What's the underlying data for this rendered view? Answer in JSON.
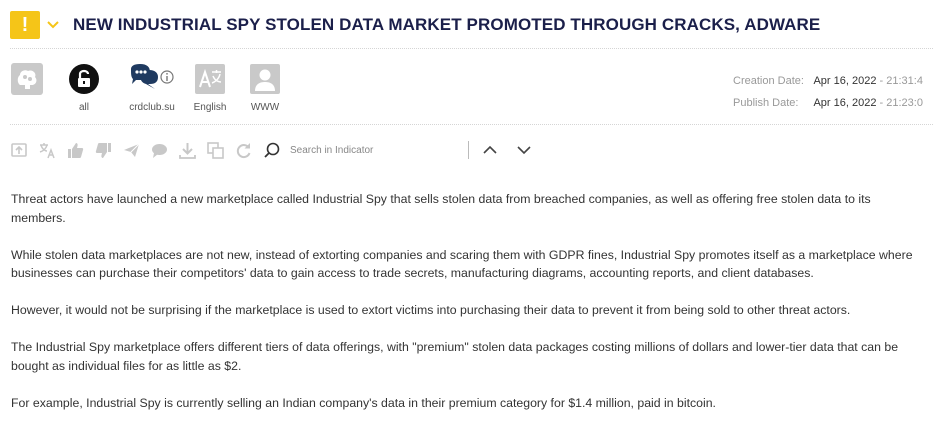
{
  "header": {
    "badge": "!",
    "title": "NEW INDUSTRIAL SPY STOLEN DATA MARKET PROMOTED THROUGH CRACKS, ADWARE"
  },
  "meta": {
    "items": [
      {
        "icon": "brain-icon",
        "label": ""
      },
      {
        "icon": "lock-open-icon",
        "label": "all"
      },
      {
        "icon": "chat-icon",
        "label": "crdclub.su"
      },
      {
        "icon": "translate-icon",
        "label": "English"
      },
      {
        "icon": "user-icon",
        "label": "WWW"
      }
    ]
  },
  "dates": {
    "creation_label": "Creation Date:",
    "creation_date": "Apr 16, 2022",
    "creation_time": "21:31:4",
    "publish_label": "Publish Date:",
    "publish_date": "Apr 16, 2022",
    "publish_time": "21:23:0"
  },
  "toolbar": {
    "search_placeholder": "Search in Indicator"
  },
  "content": {
    "paragraphs": [
      "Threat actors have launched a new marketplace called Industrial Spy that sells stolen data from breached companies, as well as offering free stolen data to its members.",
      "While stolen data marketplaces are not new, instead of extorting companies and scaring them with GDPR fines, Industrial Spy promotes itself as a marketplace where businesses can purchase their competitors' data to gain access to trade secrets, manufacturing diagrams, accounting reports, and client databases.",
      "However, it would not be surprising if the marketplace is used to extort victims into purchasing their data to prevent it from being sold to other threat actors.",
      "The Industrial Spy marketplace offers different tiers of data offerings, with \"premium\" stolen data packages costing millions of dollars and lower-tier data that can be bought as individual files for as little as $2.",
      "For example, Industrial Spy is currently selling an Indian company's data in their premium category for $1.4 million, paid in bitcoin."
    ]
  },
  "colors": {
    "badge": "#f5c518",
    "title": "#1b1f4a",
    "muted_icon": "#c8c8c8",
    "chat_icon": "#1f3a60"
  }
}
